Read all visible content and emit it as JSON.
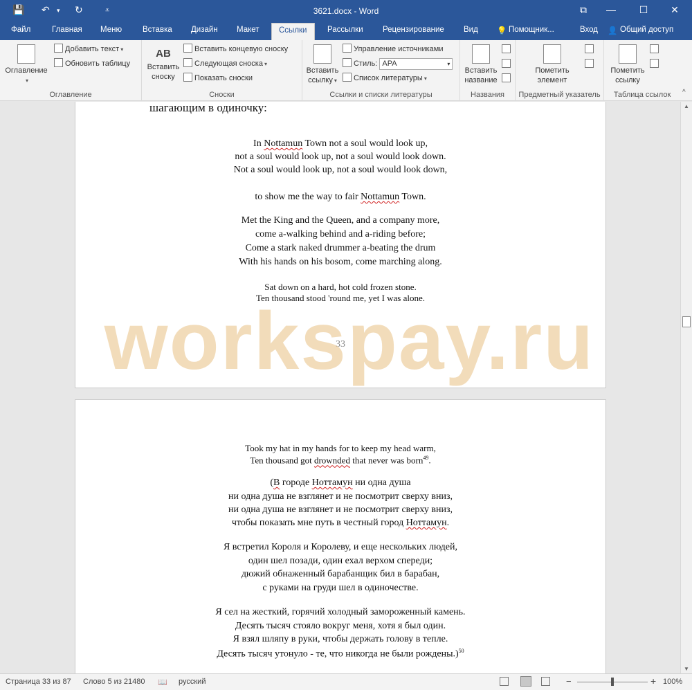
{
  "window": {
    "title": "3621.docx - Word",
    "minimize": "—",
    "maximize": "☐",
    "close": "✕",
    "ribbon_display": "⧉"
  },
  "quick_access": {
    "save": "💾",
    "undo": "↶",
    "undo_dd": "▾",
    "redo": "↻",
    "customize": "⩡"
  },
  "tabs": [
    {
      "label": "Файл"
    },
    {
      "label": "Главная"
    },
    {
      "label": "Меню"
    },
    {
      "label": "Вставка"
    },
    {
      "label": "Дизайн"
    },
    {
      "label": "Макет"
    },
    {
      "label": "Ссылки"
    },
    {
      "label": "Рассылки"
    },
    {
      "label": "Рецензирование"
    },
    {
      "label": "Вид"
    },
    {
      "label": "Помощник..."
    }
  ],
  "tab_right": {
    "login": "Вход",
    "share": "Общий доступ"
  },
  "ribbon": {
    "toc": {
      "button": "Оглавление",
      "add_text": "Добавить текст",
      "update_table": "Обновить таблицу",
      "label": "Оглавление"
    },
    "footnotes": {
      "insert_footnote_l1": "Вставить",
      "insert_footnote_l2": "сноску",
      "ab_icon": "AB",
      "insert_endnote": "Вставить концевую сноску",
      "next_footnote": "Следующая сноска",
      "show_notes": "Показать сноски",
      "label": "Сноски"
    },
    "citations": {
      "insert_citation_l1": "Вставить",
      "insert_citation_l2": "ссылку",
      "manage_sources": "Управление источниками",
      "style_label": "Стиль:",
      "style_value": "APA",
      "bibliography": "Список литературы",
      "label": "Ссылки и списки литературы"
    },
    "captions": {
      "insert_caption_l1": "Вставить",
      "insert_caption_l2": "название",
      "label": "Названия"
    },
    "index": {
      "mark_entry_l1": "Пометить",
      "mark_entry_l2": "элемент",
      "label": "Предметный указатель"
    },
    "toa": {
      "mark_citation_l1": "Пометить",
      "mark_citation_l2": "ссылку",
      "label": "Таблица ссылок"
    }
  },
  "document": {
    "page1": {
      "top_fragment": "шагающим в одиночку:",
      "s1_pre": "In ",
      "s1_word": "Nottamun",
      "s1_post": " Town not a soul would look up,",
      "l2": "not a soul would look up, not a soul would look down.",
      "l3": "Not a soul would look up, not a soul would look down,",
      "l4_pre": "to show me the way to fair ",
      "l4_word": "Nottamun",
      "l4_post": " Town.",
      "l5": "Met the King and the Queen, and a company more,",
      "l6": "come a-walking behind and a-riding before;",
      "l7": "Come a stark naked drummer a-beating the drum",
      "l8": "With his hands on his bosom, come marching along.",
      "l9": "Sat down on a hard, hot cold frozen stone.",
      "l10": "Ten thousand stood 'round me, yet I was alone.",
      "page_number": "33"
    },
    "page2": {
      "l1": "Took my hat in my hands for to keep my head warm,",
      "l2_pre": "Ten thousand got ",
      "l2_word": "drownded",
      "l2_post": " that never was born",
      "l2_sup": "49",
      "l2_end": ".",
      "r1_a": "(",
      "r1_b": "В",
      "r1_c": " городе ",
      "r1_d": "Ноттамун",
      "r1_e": " ни одна душа",
      "r2": "ни одна душа не взглянет и не посмотрит сверху вниз,",
      "r3": "ни одна душа не взглянет и не посмотрит сверху вниз,",
      "r4_pre": "чтобы показать мне путь в честный город ",
      "r4_word": "Ноттамун",
      "r4_post": ".",
      "r5": "Я встретил Короля и Королеву, и еще нескольких людей,",
      "r6": "один шел позади, один ехал верхом спереди;",
      "r7": "дюжий обнаженный барабанщик бил в барабан,",
      "r8": "с руками на груди шел в одиночестве.",
      "r9": "Я сел на жесткий, горячий холодный замороженный камень.",
      "r10": "Десять тысяч стояло вокруг меня, хотя я был один.",
      "r11": "Я взял шляпу в руки, чтобы держать голову в тепле.",
      "r12": "Десять тысяч утонуло - те, что никогда не были рождены.)",
      "r12_sup": "50"
    }
  },
  "watermark": "workspay.ru",
  "statusbar": {
    "page": "Страница 33 из 87",
    "words": "Слово 5 из 21480",
    "language": "русский",
    "zoom_minus": "−",
    "zoom_plus": "+",
    "zoom": "100%"
  },
  "colors": {
    "accent": "#2b579a",
    "ribbon_bg": "#f3f3f3",
    "canvas": "#e7e7e7"
  }
}
